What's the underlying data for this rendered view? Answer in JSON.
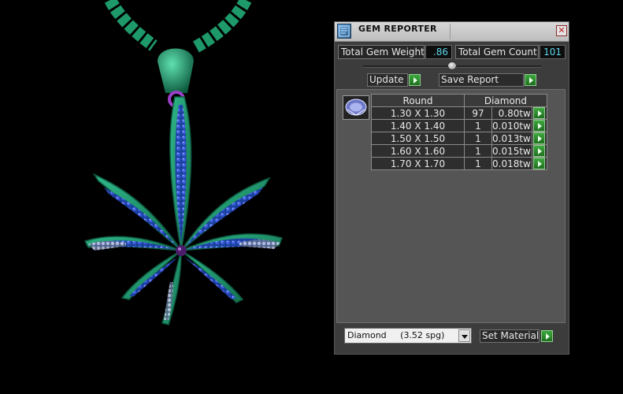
{
  "window": {
    "title": "GEM REPORTER",
    "close_glyph": "✕"
  },
  "summary": {
    "weight_label": "Total Gem Weight",
    "weight_value": ".86",
    "count_label": "Total Gem Count",
    "count_value": "101"
  },
  "buttons": {
    "update": "Update",
    "save_report": "Save Report",
    "set_material": "Set Material"
  },
  "table": {
    "headers": {
      "cut": "Round",
      "material": "Diamond"
    },
    "rows": [
      {
        "size": "1.30 X 1.30",
        "count": "97",
        "weight": "0.80tw"
      },
      {
        "size": "1.40 X 1.40",
        "count": "1",
        "weight": "0.010tw"
      },
      {
        "size": "1.50 X 1.50",
        "count": "1",
        "weight": "0.013tw"
      },
      {
        "size": "1.60 X 1.60",
        "count": "1",
        "weight": "0.015tw"
      },
      {
        "size": "1.70 X 1.70",
        "count": "1",
        "weight": "0.018tw"
      }
    ]
  },
  "material_select": {
    "value": "Diamond     (3.52 spg)"
  },
  "icons": {
    "app": "gem-reporter-app-icon",
    "close": "close-icon",
    "gem": "round-gem-icon",
    "go": "green-play-arrow-icon",
    "dropdown": "chevron-down-icon"
  },
  "colors": {
    "pendant_green": "#1f9e6e",
    "gem_blue": "#2b3fd0",
    "value_text": "#5fd7ea",
    "go_button": "#2e8f2e"
  }
}
